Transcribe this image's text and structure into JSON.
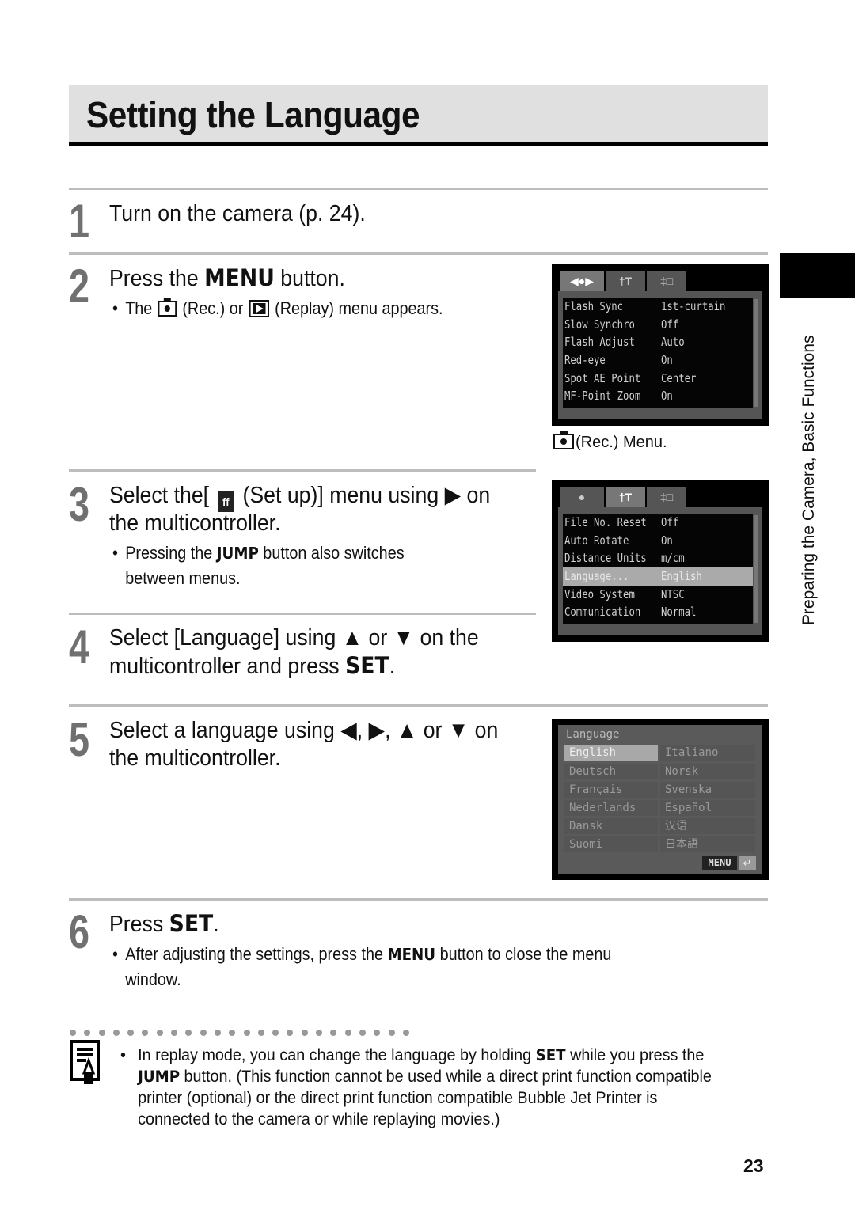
{
  "page": {
    "title": "Setting the Language",
    "page_number": "23",
    "section_tab": "Preparing the Camera, Basic Functions"
  },
  "steps": [
    {
      "number": "1",
      "text": "Turn on the camera (p. 24)."
    },
    {
      "number": "2",
      "text_pre": "Press the ",
      "keyword": "MENU",
      "text_post": " button.",
      "bullets": [
        {
          "pre": "The ",
          "rec_label": " (Rec.) or ",
          "replay_label": " (Replay) menu appears."
        }
      ]
    },
    {
      "number": "3",
      "line1_pre": "Select the[ ",
      "line1_post": " (Set up)] menu using ▶ on",
      "line2": "the multicontroller.",
      "bullets": [
        {
          "pre": "Pressing the ",
          "keyword": "JUMP",
          "post": " button also switches",
          "cont": "between menus."
        }
      ]
    },
    {
      "number": "4",
      "line1": "Select [Language] using ▲ or ▼ on the",
      "line2_pre": "multicontroller and press ",
      "keyword": "SET",
      "line2_post": "."
    },
    {
      "number": "5",
      "line1": "Select a language using ◀, ▶, ▲ or ▼ on",
      "line2": "the multicontroller."
    },
    {
      "number": "6",
      "text_pre": "Press ",
      "keyword": "SET",
      "text_post": ".",
      "bullets": [
        {
          "pre": "After adjusting the settings, press the ",
          "keyword": "MENU",
          "post": " button to close the menu",
          "cont": "window."
        }
      ]
    }
  ],
  "screens": {
    "rec_menu": {
      "tabs": [
        "◀●▶",
        "†T",
        "‡□"
      ],
      "active_tab": 0,
      "rows": [
        {
          "key": "Flash Sync",
          "value": "1st-curtain"
        },
        {
          "key": "Slow Synchro",
          "value": "Off"
        },
        {
          "key": "Flash Adjust",
          "value": "Auto"
        },
        {
          "key": "Red-eye",
          "value": "On"
        },
        {
          "key": "Spot AE Point",
          "value": "Center"
        },
        {
          "key": "MF-Point Zoom",
          "value": "On"
        }
      ],
      "caption": "(Rec.) Menu."
    },
    "setup_menu": {
      "tabs": [
        "●",
        "†T",
        "‡□"
      ],
      "active_tab": 1,
      "rows": [
        {
          "key": "File No. Reset",
          "value": "Off"
        },
        {
          "key": "Auto Rotate",
          "value": "On"
        },
        {
          "key": "Distance Units",
          "value": "m/cm"
        },
        {
          "key": "Language...",
          "value": "English",
          "selected": true
        },
        {
          "key": "Video System",
          "value": "NTSC"
        },
        {
          "key": "Communication",
          "value": "Normal"
        }
      ]
    },
    "language_menu": {
      "title": "Language",
      "left": [
        "English",
        "Deutsch",
        "Français",
        "Nederlands",
        "Dansk",
        "Suomi"
      ],
      "right": [
        "Italiano",
        "Norsk",
        "Svenska",
        "Español",
        "汉语",
        "日本語"
      ],
      "selected": "English",
      "footer_button": "MENU",
      "footer_icon": "↵"
    }
  },
  "note": {
    "pre": "In replay mode, you can change the language by holding ",
    "kw1": "SET",
    "mid": " while you press the ",
    "kw2": "JUMP",
    "post": " button. (This function cannot be used while a direct print function compatible printer (optional) or the direct print function compatible Bubble Jet Printer is connected to the camera or while replaying movies.)"
  }
}
